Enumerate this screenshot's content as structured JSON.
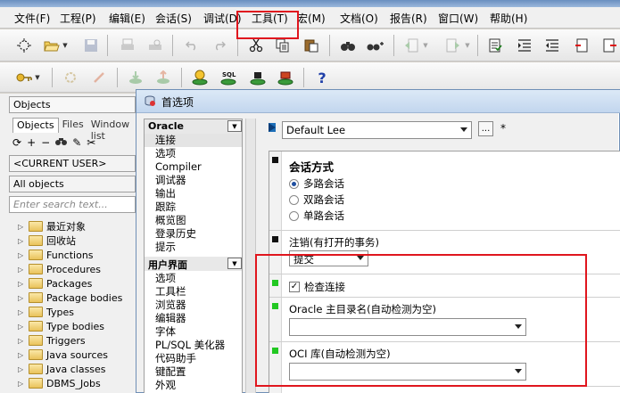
{
  "menubar": {
    "items": [
      "文件(F)",
      "工程(P)",
      "编辑(E)",
      "会话(S)",
      "调试(D)",
      "工具(T)",
      "宏(M)",
      "文档(O)",
      "报告(R)",
      "窗口(W)",
      "帮助(H)"
    ]
  },
  "toolbar1": {
    "icons": [
      "new-icon",
      "open-icon",
      "save-icon",
      "print-icon",
      "print-preview-icon",
      "undo-icon",
      "redo-icon",
      "cut-icon",
      "copy-icon",
      "paste-icon",
      "find-icon",
      "find-next-icon",
      "back-icon",
      "forward-icon",
      "compile-icon",
      "indent-icon",
      "unindent-icon",
      "uppercase-icon",
      "lowercase-icon"
    ]
  },
  "toolbar2": {
    "icons": [
      "log-on-icon",
      "execute-icon",
      "break-icon",
      "commit-icon",
      "rollback-icon",
      "explain-icon",
      "sql-icon",
      "trace-icon",
      "session-icon",
      "help-icon"
    ],
    "help_glyph": "?"
  },
  "left_panel": {
    "title": "Objects",
    "tabs": [
      "Objects",
      "Files",
      "Window list"
    ],
    "user_select": "<CURRENT USER>",
    "filter_select": "All objects",
    "search_placeholder": "Enter search text...",
    "tree": [
      "最近对象",
      "回收站",
      "Functions",
      "Procedures",
      "Packages",
      "Package bodies",
      "Types",
      "Type bodies",
      "Triggers",
      "Java sources",
      "Java classes",
      "DBMS_Jobs"
    ]
  },
  "dialog": {
    "title": "首选项",
    "profile_select": "Default Lee",
    "more_label": "...",
    "star_label": "*",
    "categories": {
      "oracle_header": "Oracle",
      "oracle_items": [
        "连接",
        "选项",
        "Compiler",
        "调试器",
        "输出",
        "跟踪",
        "概览图",
        "登录历史",
        "提示"
      ],
      "ui_header": "用户界面",
      "ui_items": [
        "选项",
        "工具栏",
        "浏览器",
        "编辑器",
        "字体",
        "PL/SQL 美化器",
        "代码助手",
        "键配置",
        "外观"
      ]
    },
    "settings": {
      "session_mode_label": "会话方式",
      "session_modes": [
        "多路会话",
        "双路会话",
        "单路会话"
      ],
      "session_mode_selected": 0,
      "logoff_label": "注销(有打开的事务)",
      "logoff_value": "提交",
      "check_connection_label": "检查连接",
      "check_connection_checked": true,
      "check_mark": "✓",
      "oracle_home_label": "Oracle 主目录名(自动检测为空)",
      "oracle_home_value": "",
      "oci_label": "OCI 库(自动检测为空)",
      "oci_value": ""
    }
  },
  "colors": {
    "highlight_red": "#e0161e",
    "marker_black": "#111111",
    "marker_green": "#22c822",
    "selection_gray": "#e4e4e4"
  }
}
